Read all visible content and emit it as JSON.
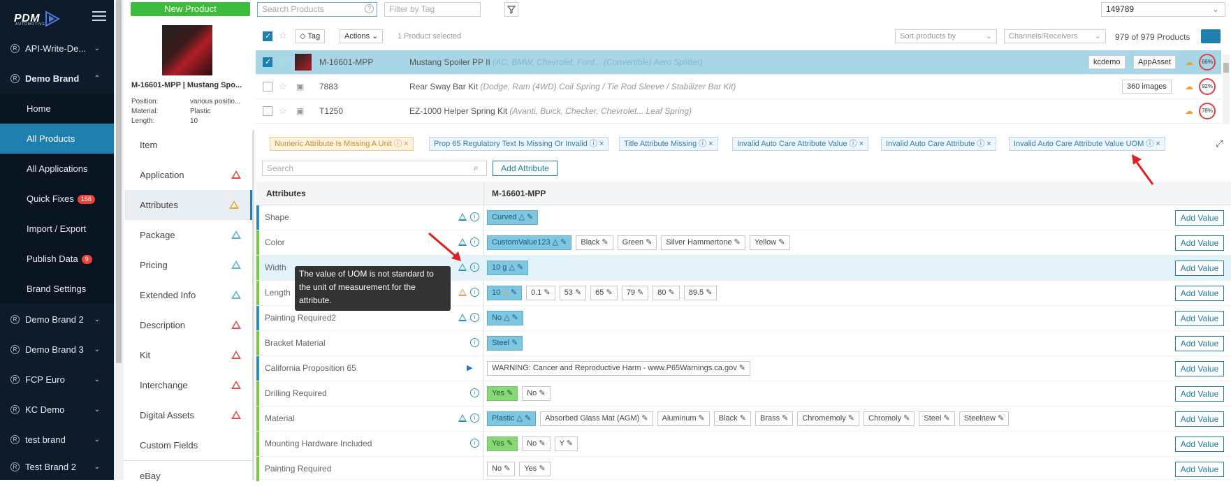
{
  "sidebar": {
    "logo": "PDM",
    "logo_sub": "AUTOMOTIVE",
    "items": [
      {
        "label": "API-Write-De..."
      },
      {
        "label": "Demo Brand"
      },
      {
        "label": "Demo Brand 2"
      },
      {
        "label": "Demo Brand 3"
      },
      {
        "label": "FCP Euro"
      },
      {
        "label": "KC Demo"
      },
      {
        "label": "test brand"
      },
      {
        "label": "Test Brand 2"
      }
    ],
    "sub": [
      {
        "label": "Home"
      },
      {
        "label": "All Products"
      },
      {
        "label": "All Applications"
      },
      {
        "label": "Quick Fixes",
        "badge": "158"
      },
      {
        "label": "Import / Export"
      },
      {
        "label": "Publish Data",
        "badge": "9"
      },
      {
        "label": "Brand Settings"
      }
    ]
  },
  "topbar": {
    "new_product": "New Product",
    "search_placeholder": "Search Products",
    "filter_placeholder": "Filter by Tag",
    "account": "149789"
  },
  "preview": {
    "title": "M-16601-MPP | Mustang Spo...",
    "rows": [
      {
        "k": "Position:",
        "v": "various positio..."
      },
      {
        "k": "Material:",
        "v": "Plastic"
      },
      {
        "k": "Length:",
        "v": "10"
      }
    ]
  },
  "list": {
    "tag": "Tag",
    "actions": "Actions",
    "selected": "1 Product selected",
    "sort": "Sort products by",
    "channels": "Channels/Receivers",
    "count": "979 of 979 Products",
    "rows": [
      {
        "sku": "M-16601-MPP",
        "name": "Mustang Spoiler PP II",
        "apps": "(AC, BMW, Chevrolet, Ford... (Convertible) Aero Splitter)",
        "tags": [
          "kcdemo",
          "AppAsset"
        ],
        "pct": "66%"
      },
      {
        "sku": "7883",
        "name": "Rear Sway Bar Kit",
        "apps": "(Dodge, Ram (4WD) Coil Spring / Tie Rod Sleeve / Stabilizer Bar Kit)",
        "tags": [
          "360 images"
        ],
        "pct": "92%"
      },
      {
        "sku": "T1250",
        "name": "EZ-1000 Helper Spring Kit",
        "apps": "(Avanti, Buick, Checker, Chevrolet... Leaf Spring)",
        "tags": [],
        "pct": "78%"
      }
    ]
  },
  "tabs": [
    {
      "label": "Item",
      "warn": ""
    },
    {
      "label": "Application",
      "warn": "red"
    },
    {
      "label": "Attributes",
      "warn": "orange"
    },
    {
      "label": "Package",
      "warn": "blue"
    },
    {
      "label": "Pricing",
      "warn": "blue"
    },
    {
      "label": "Extended Info",
      "warn": "blue"
    },
    {
      "label": "Description",
      "warn": "red"
    },
    {
      "label": "Kit",
      "warn": "red"
    },
    {
      "label": "Interchange",
      "warn": "red"
    },
    {
      "label": "Digital Assets",
      "warn": "red"
    },
    {
      "label": "Custom Fields",
      "warn": ""
    },
    {
      "label": "eBay",
      "warn": ""
    }
  ],
  "issues": [
    "Numeric Attribute Is Missing A Unit",
    "Prop 65 Regulatory Text Is Missing Or Invalid",
    "Title Attribute Missing",
    "Invalid Auto Care Attribute Value",
    "Invalid Auto Care Attribute",
    "Invalid Auto Care Attribute Value UOM"
  ],
  "attr": {
    "search_placeholder": "Search",
    "add_attribute": "Add Attribute",
    "col_attributes": "Attributes",
    "col_product": "M-16601-MPP",
    "add_value": "Add Value",
    "rows": [
      {
        "name": "Shape",
        "values": [
          "Curved"
        ]
      },
      {
        "name": "Color",
        "values": [
          "CustomValue123",
          "Black",
          "Green",
          "Silver Hammertone",
          "Yellow"
        ]
      },
      {
        "name": "Width",
        "values": [
          "10 g"
        ]
      },
      {
        "name": "Length",
        "values": [
          "10",
          "0.1",
          "53",
          "65",
          "79",
          "80",
          "89.5"
        ]
      },
      {
        "name": "Painting Required2",
        "values": [
          "No"
        ]
      },
      {
        "name": "Bracket Material",
        "values": [
          "Steel"
        ]
      },
      {
        "name": "California Proposition 65",
        "values": [
          "WARNING: Cancer and Reproductive Harm - www.P65Warnings.ca.gov"
        ]
      },
      {
        "name": "Drilling Required",
        "values": [
          "Yes",
          "No"
        ]
      },
      {
        "name": "Material",
        "values": [
          "Plastic",
          "Absorbed Glass Mat (AGM)",
          "Aluminum",
          "Black",
          "Brass",
          "Chromemoly",
          "Chromoly",
          "Steel",
          "Steelnew"
        ]
      },
      {
        "name": "Mounting Hardware Included",
        "values": [
          "Yes",
          "No",
          "Y"
        ]
      },
      {
        "name": "Painting Required",
        "values": [
          "No",
          "Yes"
        ]
      }
    ]
  },
  "tooltip": "The value of UOM is not standard to the unit of measurement for the attribute.",
  "colors": {
    "sidebar": "#0d1b2a",
    "active": "#1e7fae",
    "green": "#3dbb3a",
    "warn": "#e05050"
  }
}
